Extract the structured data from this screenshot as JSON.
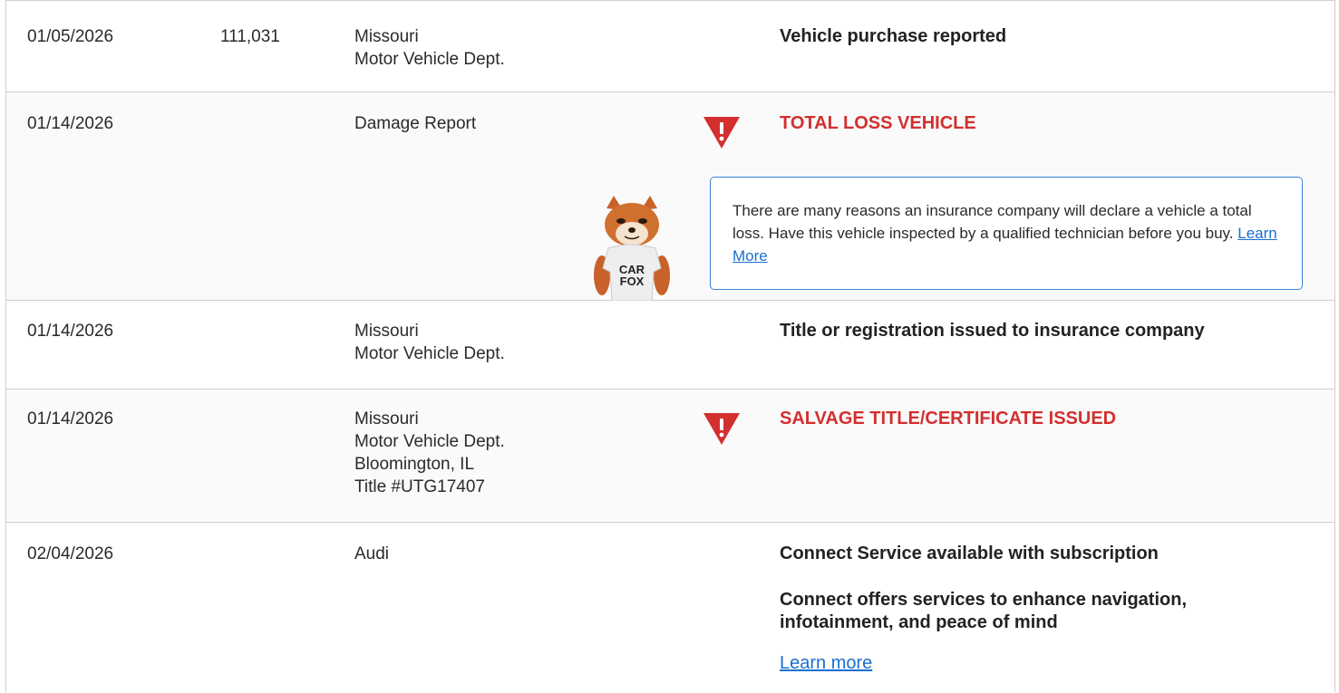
{
  "rows": [
    {
      "date": "01/05/2026",
      "mileage": "111,031",
      "source": [
        "Missouri",
        "Motor Vehicle Dept."
      ],
      "comment": "Vehicle purchase reported"
    },
    {
      "date": "01/14/2026",
      "source": [
        "Damage Report"
      ],
      "comment": "TOTAL LOSS VEHICLE",
      "alert_icon": "warning-triangle-icon",
      "info_text": "There are many reasons an insurance company will declare a vehicle a total loss. Have this vehicle inspected by a qualified technician before you buy.",
      "info_link": "Learn More",
      "mascot_shirt_lines": [
        "CAR",
        "FOX"
      ]
    },
    {
      "date": "01/14/2026",
      "source": [
        "Missouri",
        "Motor Vehicle Dept."
      ],
      "comment": "Title or registration issued to insurance company"
    },
    {
      "date": "01/14/2026",
      "source": [
        "Missouri",
        "Motor Vehicle Dept.",
        "Bloomington, IL",
        "Title #UTG17407"
      ],
      "comment": "SALVAGE TITLE/CERTIFICATE ISSUED",
      "alert_icon": "warning-triangle-icon"
    },
    {
      "date": "02/04/2026",
      "source": [
        "Audi"
      ],
      "comments": [
        "Connect Service available with subscription",
        "Connect offers services to enhance navigation, infotainment, and peace of mind"
      ],
      "link": "Learn more"
    }
  ],
  "colors": {
    "alert": "#d32f2f",
    "link": "#1a6fd1",
    "info_border": "#3b82d6",
    "row_divider": "#cfcfcf"
  }
}
